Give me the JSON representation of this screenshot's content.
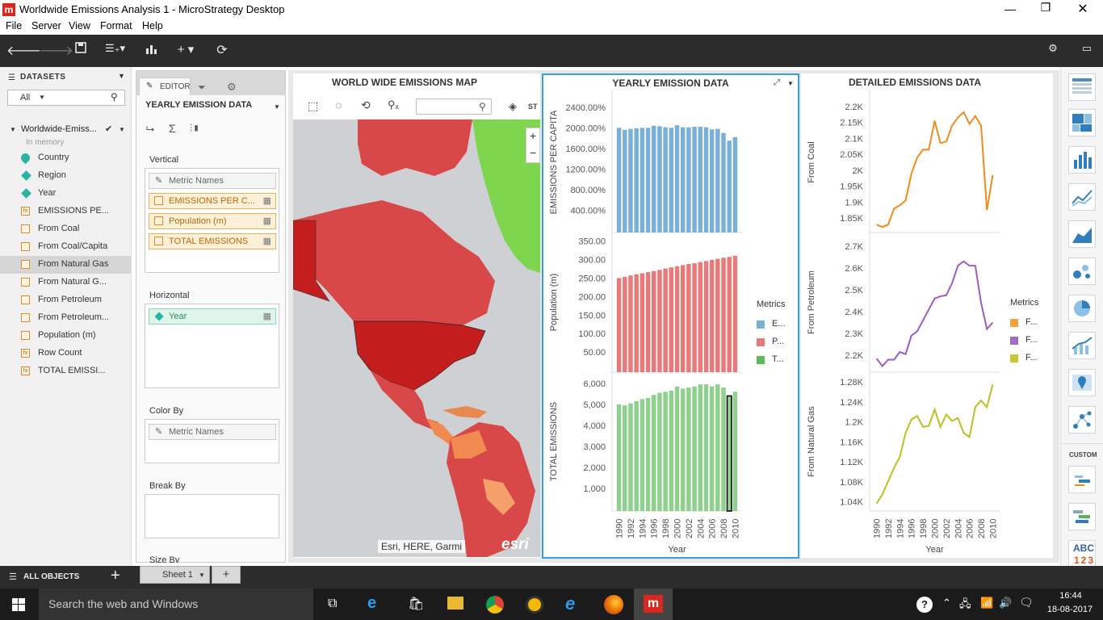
{
  "window": {
    "title": "Worldwide Emissions Analysis 1 - MicroStrategy Desktop",
    "logo": "m"
  },
  "menu": [
    "File",
    "Server",
    "View",
    "Format",
    "Help"
  ],
  "datasets": {
    "header": "DATASETS",
    "filter": "All",
    "dataset_name": "Worldwide-Emiss...",
    "dataset_status": "In memory",
    "objects": [
      {
        "label": "Country",
        "kind": "geo"
      },
      {
        "label": "Region",
        "kind": "attr"
      },
      {
        "label": "Year",
        "kind": "attr"
      },
      {
        "label": "EMISSIONS PE...",
        "kind": "fx"
      },
      {
        "label": "From Coal",
        "kind": "met"
      },
      {
        "label": "From Coal/Capita",
        "kind": "met"
      },
      {
        "label": "From Natural Gas",
        "kind": "met",
        "selected": true
      },
      {
        "label": "From Natural G...",
        "kind": "met"
      },
      {
        "label": "From Petroleum",
        "kind": "met"
      },
      {
        "label": "From Petroleum...",
        "kind": "met"
      },
      {
        "label": "Population (m)",
        "kind": "met"
      },
      {
        "label": "Row Count",
        "kind": "fx"
      },
      {
        "label": "TOTAL EMISSI...",
        "kind": "fx"
      }
    ],
    "all_objects": "ALL OBJECTS"
  },
  "editor": {
    "tab_label": "EDITOR",
    "viz_name": "YEARLY EMISSION DATA",
    "vertical_label": "Vertical",
    "vertical_items": [
      "Metric Names",
      "EMISSIONS PER C...",
      "Population (m)",
      "TOTAL EMISSIONS"
    ],
    "horizontal_label": "Horizontal",
    "horizontal_items": [
      "Year"
    ],
    "colorby_label": "Color By",
    "colorby_items": [
      "Metric Names"
    ],
    "breakby_label": "Break By",
    "sizeby_label": "Size By"
  },
  "map_viz": {
    "title": "WORLD WIDE EMISSIONS MAP",
    "attribution": "Esri, HERE, Garmi",
    "esri_logo": "esri",
    "zoom_in": "+",
    "zoom_out": "−",
    "toolbar_extra": "ST"
  },
  "yearly": {
    "title": "YEARLY EMISSION DATA",
    "legend_title": "Metrics",
    "legend": [
      {
        "label": "E...",
        "color": "#7ab0d8"
      },
      {
        "label": "P...",
        "color": "#ea7a7a"
      },
      {
        "label": "T...",
        "color": "#5cb85c"
      }
    ],
    "xlabel": "Year"
  },
  "detailed": {
    "title": "DETAILED EMISSIONS DATA",
    "legend_title": "Metrics",
    "legend": [
      {
        "label": "F...",
        "color": "#f5a03c"
      },
      {
        "label": "F...",
        "color": "#a56cc1"
      },
      {
        "label": "F...",
        "color": "#c8c832"
      }
    ],
    "xlabel": "Year"
  },
  "chart_data": [
    {
      "type": "bar",
      "title": "YEARLY EMISSION DATA",
      "categories": [
        "1990",
        "1991",
        "1992",
        "1993",
        "1994",
        "1995",
        "1996",
        "1997",
        "1998",
        "1999",
        "2000",
        "2001",
        "2002",
        "2003",
        "2004",
        "2005",
        "2006",
        "2007",
        "2008",
        "2009",
        "2010"
      ],
      "x_tick_labels": [
        "1990",
        "1992",
        "1994",
        "1996",
        "1998",
        "2000",
        "2002",
        "2004",
        "2006",
        "2008",
        "2010"
      ],
      "xlabel": "Year",
      "panels": [
        {
          "name": "EMISSIONS PER CAPITA",
          "ylabel": "EMISSIONS PER CAPITA",
          "color": "#7ab0d8",
          "ylim": [
            0,
            2600
          ],
          "ticks": [
            "2400.00%",
            "2000.00%",
            "1600.00%",
            "1200.00%",
            "800.00%",
            "400.00%"
          ],
          "tick_values": [
            2400,
            2000,
            1600,
            1200,
            800,
            400
          ],
          "values": [
            2000,
            1960,
            1980,
            1990,
            2000,
            2000,
            2040,
            2030,
            2010,
            2000,
            2050,
            2010,
            2010,
            2020,
            2020,
            2010,
            1970,
            1980,
            1900,
            1750,
            1820
          ]
        },
        {
          "name": "Population (m)",
          "ylabel": "Population (m)",
          "color": "#ea7a7a",
          "ylim": [
            0,
            360
          ],
          "ticks": [
            "350.00",
            "300.00",
            "250.00",
            "200.00",
            "150.00",
            "100.00",
            "50.00"
          ],
          "tick_values": [
            350,
            300,
            250,
            200,
            150,
            100,
            50
          ],
          "values": [
            250,
            253,
            257,
            260,
            263,
            266,
            269,
            272,
            276,
            279,
            282,
            285,
            288,
            290,
            293,
            296,
            299,
            302,
            305,
            307,
            310
          ]
        },
        {
          "name": "TOTAL EMISSIONS",
          "ylabel": "TOTAL EMISSIONS",
          "color": "#8fd08f",
          "ylim": [
            0,
            6300
          ],
          "ticks": [
            "6,000",
            "5,000",
            "4,000",
            "3,000",
            "2,000",
            "1,000"
          ],
          "tick_values": [
            6000,
            5000,
            4000,
            3000,
            2000,
            1000
          ],
          "values": [
            5000,
            4950,
            5050,
            5150,
            5250,
            5300,
            5450,
            5550,
            5600,
            5650,
            5850,
            5750,
            5800,
            5850,
            5950,
            5950,
            5850,
            5950,
            5800,
            5400,
            5600
          ]
        }
      ]
    },
    {
      "type": "line",
      "title": "DETAILED EMISSIONS DATA",
      "x": [
        "1990",
        "1991",
        "1992",
        "1993",
        "1994",
        "1995",
        "1996",
        "1997",
        "1998",
        "1999",
        "2000",
        "2001",
        "2002",
        "2003",
        "2004",
        "2005",
        "2006",
        "2007",
        "2008",
        "2009",
        "2010"
      ],
      "x_tick_labels": [
        "1990",
        "1992",
        "1994",
        "1996",
        "1998",
        "2000",
        "2002",
        "2004",
        "2006",
        "2008",
        "2010"
      ],
      "xlabel": "Year",
      "panels": [
        {
          "name": "From Coal",
          "ylabel": "From Coal",
          "color": "#f08c1e",
          "ylim": [
            1810,
            2230
          ],
          "ticks": [
            "2.2K",
            "2.15K",
            "2.1K",
            "2.05K",
            "2K",
            "1.95K",
            "1.9K",
            "1.85K"
          ],
          "tick_values": [
            2200,
            2150,
            2100,
            2050,
            2000,
            1950,
            1900,
            1850
          ],
          "values": [
            1830,
            1822,
            1830,
            1880,
            1890,
            1905,
            1990,
            2040,
            2065,
            2065,
            2155,
            2085,
            2090,
            2140,
            2165,
            2182,
            2145,
            2170,
            2140,
            1875,
            1985
          ]
        },
        {
          "name": "From Petroleum",
          "ylabel": "From Petroleum",
          "color": "#9a5cc6",
          "ylim": [
            2130,
            2740
          ],
          "ticks": [
            "2.7K",
            "2.6K",
            "2.5K",
            "2.4K",
            "2.3K",
            "2.2K"
          ],
          "tick_values": [
            2700,
            2600,
            2500,
            2400,
            2300,
            2200
          ],
          "values": [
            2185,
            2150,
            2180,
            2180,
            2215,
            2205,
            2290,
            2310,
            2360,
            2410,
            2460,
            2470,
            2475,
            2530,
            2610,
            2630,
            2610,
            2610,
            2440,
            2320,
            2350
          ]
        },
        {
          "name": "From Natural Gas",
          "ylabel": "From Natural Gas",
          "color": "#bcc022",
          "ylim": [
            1025,
            1290
          ],
          "ticks": [
            "1.28K",
            "1.24K",
            "1.2K",
            "1.16K",
            "1.12K",
            "1.08K",
            "1.04K"
          ],
          "tick_values": [
            1280,
            1240,
            1200,
            1160,
            1120,
            1080,
            1040
          ],
          "values": [
            1037,
            1055,
            1082,
            1108,
            1130,
            1178,
            1205,
            1212,
            1190,
            1192,
            1225,
            1190,
            1215,
            1202,
            1208,
            1178,
            1170,
            1230,
            1243,
            1230,
            1275
          ]
        }
      ]
    }
  ],
  "bottom": {
    "sheet_tab": "Sheet 1"
  },
  "gallery": {
    "custom_label": "CUSTOM",
    "text_sample_line1": "ABC",
    "text_sample_line2": "123"
  },
  "taskbar": {
    "search_placeholder": "Search the web and Windows",
    "time": "16:44",
    "date": "18-08-2017"
  }
}
